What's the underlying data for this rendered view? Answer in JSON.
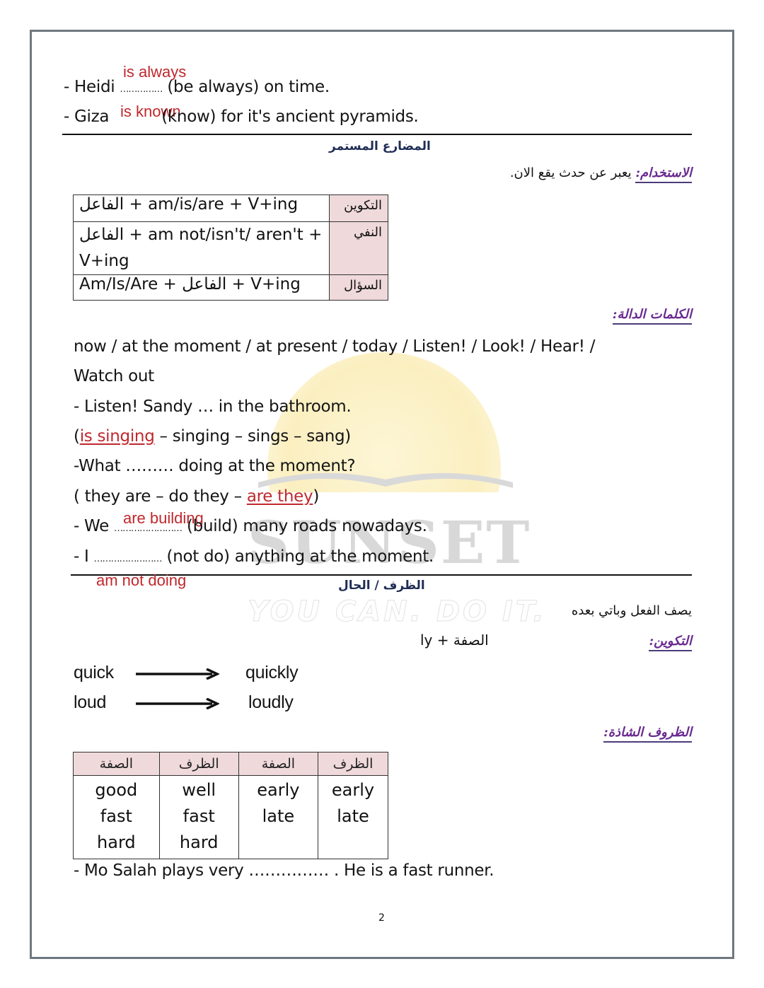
{
  "top_examples": [
    {
      "prefix": "- Heidi",
      "blank": "……………",
      "answer": "is always",
      "suffix": "(be always) on time."
    },
    {
      "prefix": "- Giza",
      "blank": "……………",
      "answer": "is known",
      "suffix": "(know) for it's ancient pyramids."
    }
  ],
  "section1": {
    "title": "المضارع المستمر",
    "usage_label": "الاستخدام:",
    "usage_text": "يعبر عن حدث يقع الان.",
    "table": [
      {
        "label": "التكوين",
        "formula": "الفاعل + am/is/are + V+ing"
      },
      {
        "label": "النفي",
        "formula": "الفاعل + am not/isn't/ aren't + V+ing"
      },
      {
        "label": "السؤال",
        "formula": "Am/Is/Are + الفاعل + V+ing"
      }
    ],
    "keywords_label": "الكلمات الدالة:",
    "keywords_line1": "now / at the moment / at present / today / Listen! / Look! / Hear! /",
    "keywords_line2": "Watch out",
    "ex1_question": "- Listen! Sandy … in the bathroom.",
    "ex1_options": {
      "open": "(",
      "correct": "is singing",
      "rest": " – singing – sings – sang)"
    },
    "ex2_question": "-What ……… doing at the moment?",
    "ex2_options": {
      "rest": "( they are – do they – ",
      "correct": "are they",
      "close": ")"
    },
    "ex3": {
      "prefix": "- We",
      "blank": "……………………",
      "answer": "are building",
      "suffix": "(build) many roads nowadays."
    },
    "ex4": {
      "prefix": "- I",
      "blank": "……………………",
      "answer": "am not doing",
      "suffix": "(not do) anything at the moment."
    }
  },
  "section2": {
    "title": "الظرف / الحال",
    "description": "يصف الفعل وباتي بعده",
    "formation_label": "التكوين:",
    "formation_text": "الصفة + ly",
    "pairs": [
      {
        "from": "quick",
        "to": "quickly"
      },
      {
        "from": "loud",
        "to": "loudly"
      }
    ],
    "irregular_label": "الظروف الشاذة:",
    "irregular_table": {
      "headers": [
        "الصفة",
        "الظرف",
        "الصفة",
        "الظرف"
      ],
      "columns": [
        [
          "good",
          "fast",
          "hard"
        ],
        [
          "well",
          "fast",
          "hard"
        ],
        [
          "early",
          "late"
        ],
        [
          "early",
          "late"
        ]
      ]
    },
    "final_example": "- Mo Salah plays very …………… . He is a fast runner."
  },
  "watermark": {
    "brand": "SUNSET",
    "slogan": "YOU CAN. DO IT."
  },
  "page_number": "2"
}
